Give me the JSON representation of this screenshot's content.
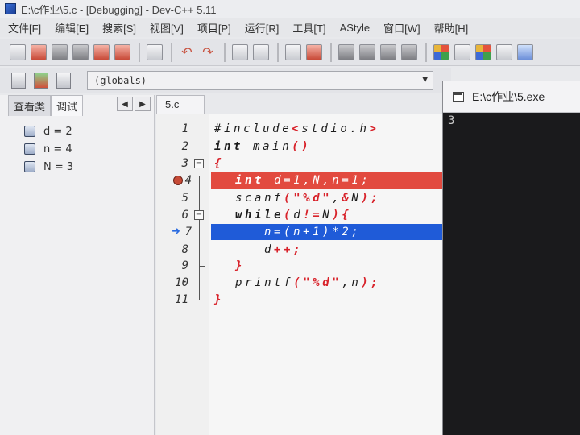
{
  "window": {
    "title": "E:\\c作业\\5.c - [Debugging] - Dev-C++ 5.11"
  },
  "menu": [
    "文件[F]",
    "编辑[E]",
    "搜索[S]",
    "视图[V]",
    "项目[P]",
    "运行[R]",
    "工具[T]",
    "AStyle",
    "窗口[W]",
    "帮助[H]"
  ],
  "scope_select": {
    "value": "(globals)"
  },
  "left_panel": {
    "tabs": [
      "查看类",
      "调试"
    ],
    "active_tab": "调试",
    "watches": [
      "d = 2",
      "n = 4",
      "N = 3"
    ]
  },
  "editor": {
    "tab_label": "5.c",
    "line_numbers": [
      "1",
      "2",
      "3",
      "4",
      "5",
      "6",
      "7",
      "8",
      "9",
      "10",
      "11"
    ],
    "breakpoint_line": 4,
    "current_line": 7,
    "colors": {
      "breakpoint": "#e24a3f",
      "current": "#1f5bd8",
      "symbol": "#d8222a"
    }
  },
  "console": {
    "title": "E:\\c作业\\5.exe",
    "output": "3"
  }
}
